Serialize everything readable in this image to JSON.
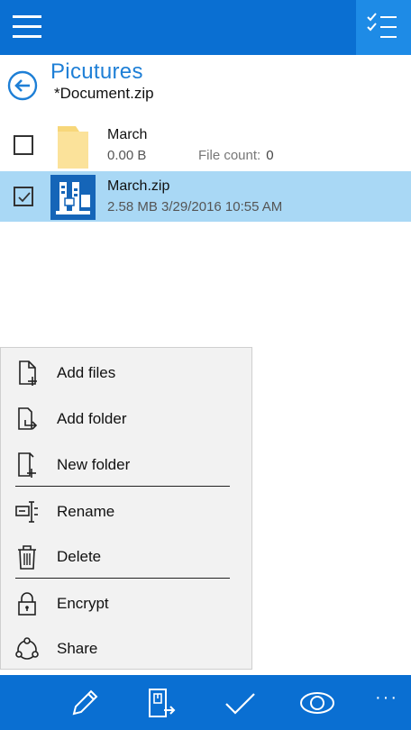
{
  "header": {
    "hamburger_icon": "hamburger-menu-icon",
    "select_icon": "multi-select-list-icon"
  },
  "breadcrumb": {
    "folder": "Picutures",
    "archive": "*Document.zip"
  },
  "files": [
    {
      "name": "March",
      "size": "0.00 B",
      "count_label": "File count:",
      "count_value": "0",
      "type": "folder",
      "checked": false
    },
    {
      "name": "March.zip",
      "info": "2.58 MB  3/29/2016 10:55 AM",
      "type": "zip",
      "checked": true
    }
  ],
  "menu": {
    "add_files": "Add files",
    "add_folder": "Add folder",
    "new_folder": "New folder",
    "rename": "Rename",
    "delete": "Delete",
    "encrypt": "Encrypt",
    "share": "Share"
  },
  "bottom": {
    "more": "···"
  },
  "colors": {
    "accent": "#0a6fd2",
    "accent_light": "#1e8be6",
    "selection": "#a9d8f5",
    "title_blue": "#1e7fd6"
  }
}
